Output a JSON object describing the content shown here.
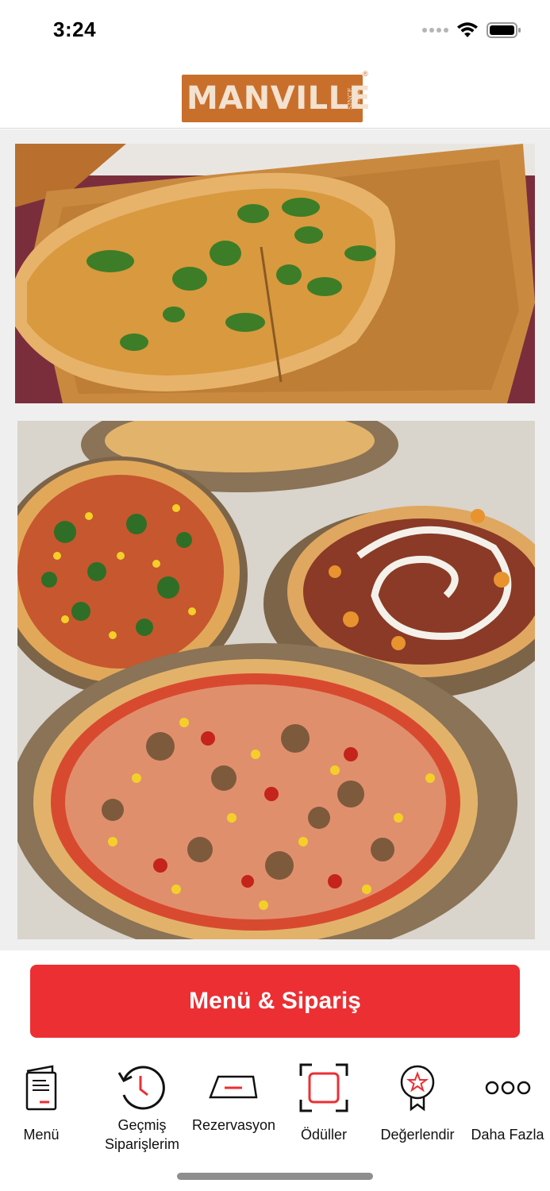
{
  "status_bar": {
    "time": "3:24"
  },
  "header": {
    "logo_text": "MANVILLE",
    "logo_since": "SINCE 1968",
    "logo_reg": "®"
  },
  "cta": {
    "label": "Menü & Sipariş"
  },
  "tabs": [
    {
      "label": "Menü",
      "icon": "menu-book-icon"
    },
    {
      "label": "Geçmiş Siparişlerim",
      "icon": "history-clock-icon"
    },
    {
      "label": "Rezervasyon",
      "icon": "reservation-table-icon"
    },
    {
      "label": "Ödüller",
      "icon": "rewards-scan-icon"
    },
    {
      "label": "Değerlendir",
      "icon": "rate-badge-icon"
    },
    {
      "label": "Daha Fazla",
      "icon": "more-dots-icon"
    }
  ],
  "colors": {
    "accent": "#ec2f33",
    "logo": "#c96f2c"
  }
}
